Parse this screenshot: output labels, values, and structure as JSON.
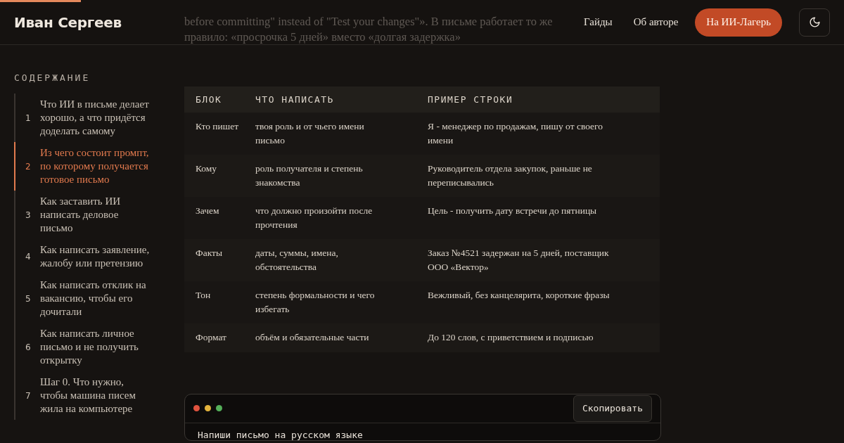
{
  "reading_progress": {
    "level": 0.096
  },
  "header": {
    "logo": "Иван Сергеев",
    "nav": [
      "Гайды",
      "Об авторе"
    ],
    "cta": "На ИИ-Лагерь"
  },
  "intro_lines": [
    "before committing\" instead of \"Test your changes\"». В письме работает то же",
    "правило: «просрочка 5 дней» вместо «долгая задержка»"
  ],
  "toc": {
    "title": "СОДЕРЖАНИЕ",
    "items": [
      {
        "number": "1",
        "label": "Что ИИ в письме делает хорошо, а что придётся доделать самому",
        "selected": false
      },
      {
        "number": "2",
        "label": "Из чего состоит промпт, по которому получается готовое письмо",
        "selected": true
      },
      {
        "number": "3",
        "label": "Как заставить ИИ написать деловое письмо",
        "selected": false
      },
      {
        "number": "4",
        "label": "Как написать заявление, жалобу или претензию",
        "selected": false
      },
      {
        "number": "5",
        "label": "Как написать отклик на вакансию, чтобы его дочитали",
        "selected": false
      },
      {
        "number": "6",
        "label": "Как написать личное письмо и не получить открытку",
        "selected": false
      },
      {
        "number": "7",
        "label": "Шаг 0. Что нужно, чтобы машина писем жила на компьютере",
        "selected": false
      }
    ]
  },
  "table": {
    "columns": [
      "БЛОК",
      "ЧТО НАПИСАТЬ",
      "ПРИМЕР СТРОКИ"
    ],
    "rows": [
      [
        "Кто пишет",
        "твоя роль и от чьего имени письмо",
        "Я - менеджер по продажам, пишу от своего имени"
      ],
      [
        "Кому",
        "роль получателя и степень знакомства",
        "Руководитель отдела закупок, раньше не переписывались"
      ],
      [
        "Зачем",
        "что должно произойти после прочтения",
        "Цель - получить дату встречи до пятницы"
      ],
      [
        "Факты",
        "даты, суммы, имена, обстоятельства",
        "Заказ №4521 задержан на 5 дней, поставщик ООО «Вектор»"
      ],
      [
        "Тон",
        "степень формальности и чего избегать",
        "Вежливый, без канцелярита, короткие фразы"
      ],
      [
        "Формат",
        "объём и обязательные части",
        "До 120 слов, с приветствием и подписью"
      ]
    ]
  },
  "code_block": {
    "copy_button": "Скопировать",
    "lines": [
      "Напиши письмо на русском языке"
    ]
  }
}
